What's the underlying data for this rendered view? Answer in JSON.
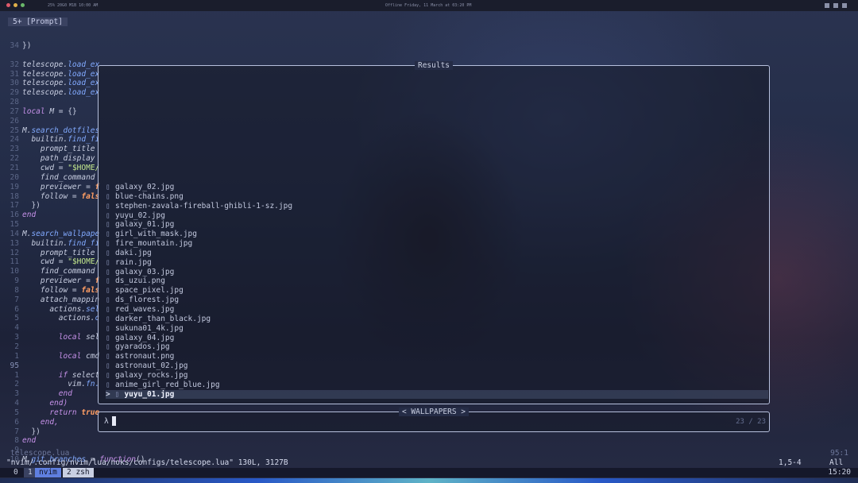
{
  "topbar": {
    "left_text": "25%   20G0 M1B   10:00 AM",
    "center_text": "Offline   Friday, 11 March at 03:20 PM"
  },
  "tab": {
    "label": "5+ [Prompt]"
  },
  "code_lines": [
    {
      "n": "34",
      "parts": [
        {
          "t": "})",
          "c": "plain"
        }
      ]
    },
    {
      "n": "",
      "parts": []
    },
    {
      "n": "32",
      "parts": [
        {
          "t": "telescope.",
          "c": "var"
        },
        {
          "t": "load_ex",
          "c": "fn"
        }
      ]
    },
    {
      "n": "31",
      "parts": [
        {
          "t": "telescope.",
          "c": "var"
        },
        {
          "t": "load_ex",
          "c": "fn"
        }
      ]
    },
    {
      "n": "30",
      "parts": [
        {
          "t": "telescope.",
          "c": "var"
        },
        {
          "t": "load_ex",
          "c": "fn"
        }
      ]
    },
    {
      "n": "29",
      "parts": [
        {
          "t": "telescope.",
          "c": "var"
        },
        {
          "t": "load_ex",
          "c": "fn"
        }
      ]
    },
    {
      "n": "28",
      "parts": []
    },
    {
      "n": "27",
      "parts": [
        {
          "t": "local ",
          "c": "kw"
        },
        {
          "t": "M",
          "c": "var"
        },
        {
          "t": " = {}",
          "c": "plain"
        }
      ]
    },
    {
      "n": "26",
      "parts": []
    },
    {
      "n": "25",
      "parts": [
        {
          "t": "M.",
          "c": "var"
        },
        {
          "t": "search_dotfiles",
          "c": "fn"
        }
      ]
    },
    {
      "n": "24",
      "parts": [
        {
          "t": "  builtin.",
          "c": "var"
        },
        {
          "t": "find_fi",
          "c": "fn"
        }
      ]
    },
    {
      "n": "23",
      "parts": [
        {
          "t": "    prompt_title",
          "c": "var"
        }
      ]
    },
    {
      "n": "22",
      "parts": [
        {
          "t": "    path_display",
          "c": "var"
        }
      ]
    },
    {
      "n": "21",
      "parts": [
        {
          "t": "    cwd",
          "c": "var"
        },
        {
          "t": " = ",
          "c": "plain"
        },
        {
          "t": "\"$HOME/",
          "c": "str"
        }
      ]
    },
    {
      "n": "20",
      "parts": [
        {
          "t": "    find_command",
          "c": "var"
        }
      ]
    },
    {
      "n": "19",
      "parts": [
        {
          "t": "    previewer",
          "c": "var"
        },
        {
          "t": " = ",
          "c": "plain"
        },
        {
          "t": "f",
          "c": "bool"
        }
      ]
    },
    {
      "n": "18",
      "parts": [
        {
          "t": "    follow",
          "c": "var"
        },
        {
          "t": " = ",
          "c": "plain"
        },
        {
          "t": "fals",
          "c": "bool"
        }
      ]
    },
    {
      "n": "17",
      "parts": [
        {
          "t": "  })",
          "c": "plain"
        }
      ]
    },
    {
      "n": "16",
      "parts": [
        {
          "t": "end",
          "c": "kw"
        }
      ]
    },
    {
      "n": "15",
      "parts": []
    },
    {
      "n": "14",
      "parts": [
        {
          "t": "M.",
          "c": "var"
        },
        {
          "t": "search_wallpape",
          "c": "fn"
        }
      ]
    },
    {
      "n": "13",
      "parts": [
        {
          "t": "  builtin.",
          "c": "var"
        },
        {
          "t": "find_fi",
          "c": "fn"
        }
      ]
    },
    {
      "n": "12",
      "parts": [
        {
          "t": "    prompt_title",
          "c": "var"
        }
      ]
    },
    {
      "n": "11",
      "parts": [
        {
          "t": "    cwd",
          "c": "var"
        },
        {
          "t": " = ",
          "c": "plain"
        },
        {
          "t": "\"$HOME/",
          "c": "str"
        }
      ]
    },
    {
      "n": "10",
      "parts": [
        {
          "t": "    find_command",
          "c": "var"
        }
      ]
    },
    {
      "n": "9",
      "parts": [
        {
          "t": "    previewer",
          "c": "var"
        },
        {
          "t": " = ",
          "c": "plain"
        },
        {
          "t": "f",
          "c": "bool"
        }
      ]
    },
    {
      "n": "8",
      "parts": [
        {
          "t": "    follow",
          "c": "var"
        },
        {
          "t": " = ",
          "c": "plain"
        },
        {
          "t": "fals",
          "c": "bool"
        }
      ]
    },
    {
      "n": "7",
      "parts": [
        {
          "t": "    attach_mappin",
          "c": "var"
        }
      ]
    },
    {
      "n": "6",
      "parts": [
        {
          "t": "      actions.",
          "c": "var"
        },
        {
          "t": "sel",
          "c": "fn"
        }
      ]
    },
    {
      "n": "5",
      "parts": [
        {
          "t": "        actions.",
          "c": "var"
        },
        {
          "t": "c",
          "c": "fn"
        }
      ]
    },
    {
      "n": "4",
      "parts": []
    },
    {
      "n": "3",
      "parts": [
        {
          "t": "        local ",
          "c": "kw"
        },
        {
          "t": "sel",
          "c": "var"
        }
      ]
    },
    {
      "n": "2",
      "parts": []
    },
    {
      "n": "1",
      "parts": [
        {
          "t": "        local ",
          "c": "kw"
        },
        {
          "t": "cmd",
          "c": "var"
        }
      ]
    },
    {
      "n": "95",
      "cur": true,
      "parts": []
    },
    {
      "n": "1",
      "parts": [
        {
          "t": "        if ",
          "c": "kw"
        },
        {
          "t": "select",
          "c": "var"
        }
      ]
    },
    {
      "n": "2",
      "parts": [
        {
          "t": "          vim.",
          "c": "var"
        },
        {
          "t": "fn.",
          "c": "fn"
        }
      ]
    },
    {
      "n": "3",
      "parts": [
        {
          "t": "        end",
          "c": "kw"
        }
      ]
    },
    {
      "n": "4",
      "parts": [
        {
          "t": "      end)",
          "c": "kw"
        }
      ]
    },
    {
      "n": "5",
      "parts": [
        {
          "t": "      return ",
          "c": "kw"
        },
        {
          "t": "true",
          "c": "bool"
        }
      ]
    },
    {
      "n": "6",
      "parts": [
        {
          "t": "    end,",
          "c": "kw"
        }
      ]
    },
    {
      "n": "7",
      "parts": [
        {
          "t": "  })",
          "c": "plain"
        }
      ]
    },
    {
      "n": "8",
      "parts": [
        {
          "t": "end",
          "c": "kw"
        }
      ]
    },
    {
      "n": "9",
      "parts": []
    },
    {
      "n": "10",
      "parts": [
        {
          "t": "M.",
          "c": "var"
        },
        {
          "t": "git_branches",
          "c": "fn"
        },
        {
          "t": " = ",
          "c": "plain"
        },
        {
          "t": "function",
          "c": "kw"
        },
        {
          "t": "()",
          "c": "plain"
        }
      ]
    }
  ],
  "results": {
    "title": "Results",
    "items": [
      "galaxy_02.jpg",
      "blue-chains.png",
      "stephen-zavala-fireball-ghibli-1-sz.jpg",
      "yuyu_02.jpg",
      "galaxy_01.jpg",
      "girl_with_mask.jpg",
      "fire_mountain.jpg",
      "daki.jpg",
      "rain.jpg",
      "galaxy_03.jpg",
      "ds_uzui.png",
      "space_pixel.jpg",
      "ds_florest.jpg",
      "red_waves.jpg",
      "darker_than_black.jpg",
      "sukuna01_4k.jpg",
      "galaxy_04.jpg",
      "gyarados.jpg",
      "astronaut.png",
      "astronaut_02.jpg",
      "galaxy_rocks.jpg",
      "anime_girl_red_blue.jpg"
    ],
    "selected": "yuyu_01.jpg",
    "caret": ">",
    "file_icon": "▯"
  },
  "prompt": {
    "title": "< WALLPAPERS >",
    "symbol": "λ",
    "count": "23 / 23"
  },
  "statusline": {
    "file": "telescope.lua",
    "pos": "95:1"
  },
  "cmdline": {
    "message": "\"nvim/.config/nvim/lua/noks/configs/telescope.lua\" 130L, 3127B",
    "cursor_pos": "1,5-4",
    "scroll": "All"
  },
  "tmux": {
    "session": "0",
    "win1_index": "1",
    "win1_name": "nvim",
    "win2": "2  zsh",
    "clock": "15:20"
  }
}
